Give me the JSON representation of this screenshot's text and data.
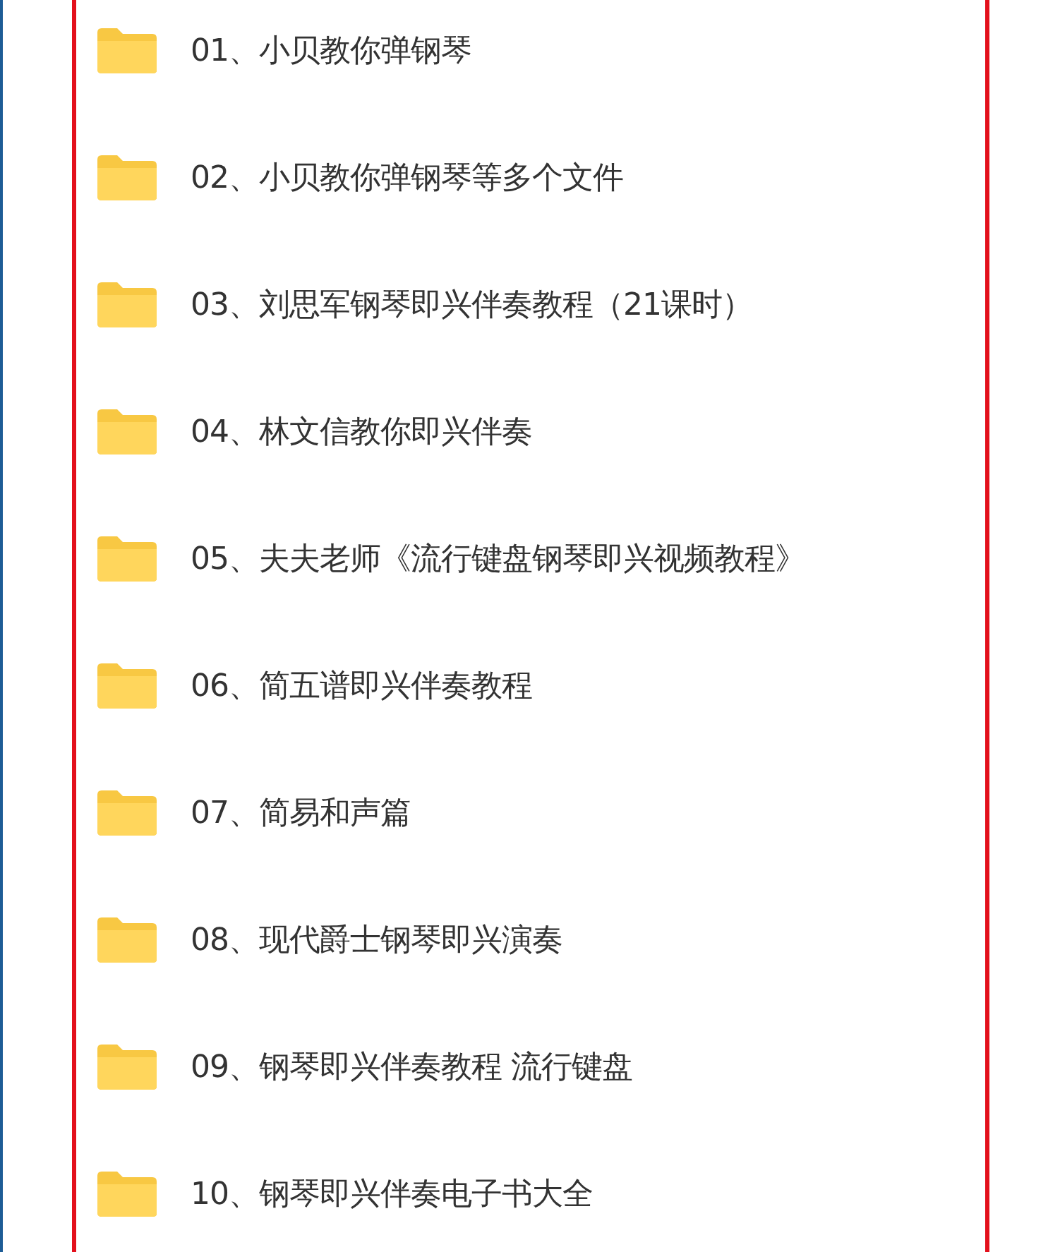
{
  "folders": [
    {
      "name": "01、小贝教你弹钢琴"
    },
    {
      "name": "02、小贝教你弹钢琴等多个文件"
    },
    {
      "name": "03、刘思军钢琴即兴伴奏教程（21课时）"
    },
    {
      "name": "04、林文信教你即兴伴奏"
    },
    {
      "name": "05、夫夫老师《流行键盘钢琴即兴视频教程》"
    },
    {
      "name": "06、简五谱即兴伴奏教程"
    },
    {
      "name": "07、简易和声篇"
    },
    {
      "name": "08、现代爵士钢琴即兴演奏"
    },
    {
      "name": "09、钢琴即兴伴奏教程 流行键盘"
    },
    {
      "name": "10、钢琴即兴伴奏电子书大全"
    }
  ]
}
